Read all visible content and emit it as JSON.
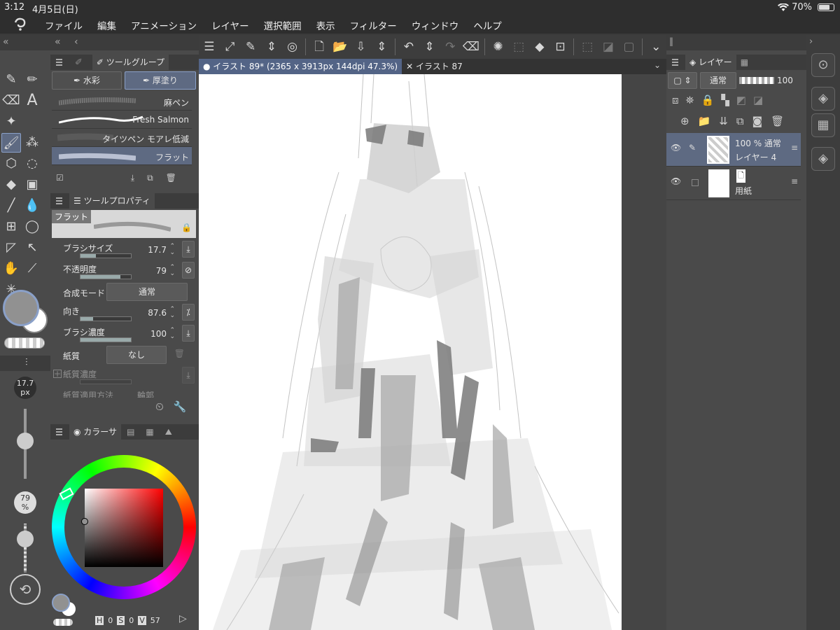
{
  "status": {
    "time": "3:12",
    "date": "4月5日(日)",
    "battery": "70%"
  },
  "menu": [
    "ファイル",
    "編集",
    "アニメーション",
    "レイヤー",
    "選択範囲",
    "表示",
    "フィルター",
    "ウィンドウ",
    "ヘルプ"
  ],
  "tabs": {
    "active": "イラスト 89* (2365 x 3913px 144dpi 47.3%)",
    "other": "イラスト 87"
  },
  "subtool": {
    "panel_title": "ツールグループ",
    "groups": [
      "水彩",
      "厚塗り"
    ],
    "brushes": [
      "麻ペン",
      "Fresh Salmon",
      "タイツペン モアレ低減",
      "フラット"
    ]
  },
  "tool_property": {
    "panel_title": "ツールプロパティ",
    "preview_label": "フラット",
    "brush_size": {
      "label": "ブラシサイズ",
      "value": "17.7",
      "fill": 0.3
    },
    "opacity": {
      "label": "不透明度",
      "value": "79",
      "fill": 0.79
    },
    "blend": {
      "label": "合成モード",
      "value": "通常"
    },
    "direction": {
      "label": "向き",
      "value": "87.6",
      "fill": 0.25
    },
    "density": {
      "label": "ブラシ濃度",
      "value": "100",
      "fill": 1.0
    },
    "texture": {
      "label": "紙質",
      "value": "なし"
    },
    "texture_density": {
      "label": "紙質濃度"
    },
    "texture_apply": {
      "label": "紙質適用方法",
      "value": "輪郭"
    }
  },
  "quick": {
    "size": "17.7",
    "size_unit": "px",
    "opacity": "79",
    "opacity_unit": "%"
  },
  "color": {
    "panel_title": "カラーサ",
    "hsv": {
      "h_label": "H",
      "h": "0",
      "s_label": "S",
      "s": "0",
      "v_label": "V",
      "v": "57"
    },
    "main_color": "#919191",
    "sub_color": "#ffffff"
  },
  "layers": {
    "panel_title": "レイヤー",
    "blend": "通常",
    "opacity": "100",
    "items": [
      {
        "meta": "100 % 通常",
        "name": "レイヤー 4"
      },
      {
        "name": "用紙"
      }
    ]
  },
  "colors": {
    "accent": "#5e6a82"
  }
}
